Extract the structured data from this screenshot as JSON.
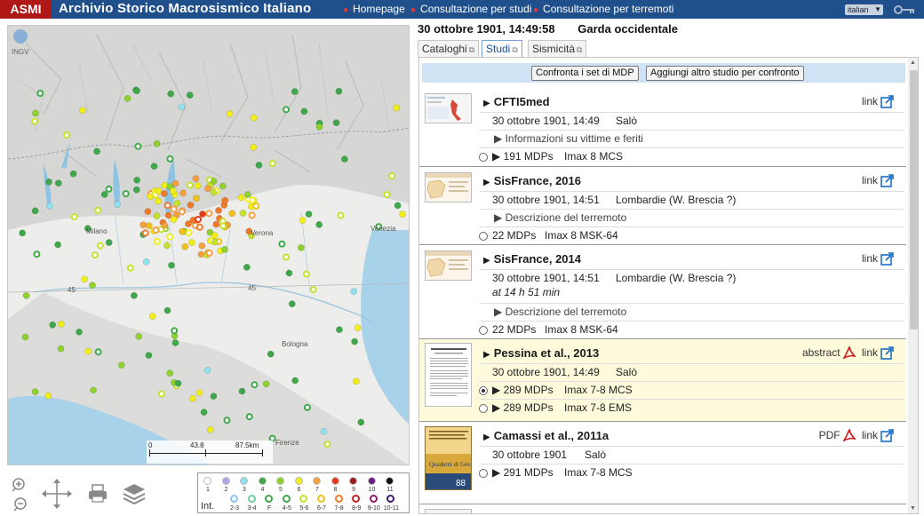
{
  "topbar": {
    "brand": "ASMI",
    "title": "Archivio Storico Macrosismico Italiano",
    "nav": [
      "Homepage",
      "Consultazione per studi",
      "Consultazione per terremoti"
    ],
    "language": "italian"
  },
  "map": {
    "labels": {
      "milano": "Milano",
      "venezia": "Venezia",
      "bologna": "Bologna",
      "firenze": "Firenze",
      "verona": "Verona",
      "lat45a": "45",
      "lat45b": "45"
    },
    "scale": {
      "zero": "0",
      "mid": "43.8",
      "end": "87.5km"
    },
    "logo": "INGV"
  },
  "legend": {
    "int_label": "Int.",
    "row1": [
      {
        "label": "1",
        "color": "#ffffff"
      },
      {
        "label": "2",
        "color": "#a9a9e8"
      },
      {
        "label": "3",
        "color": "#8fe2ef"
      },
      {
        "label": "4",
        "color": "#3fa84a"
      },
      {
        "label": "5",
        "color": "#8fd12f"
      },
      {
        "label": "6",
        "color": "#f2ee1a"
      },
      {
        "label": "7",
        "color": "#f5a142"
      },
      {
        "label": "8",
        "color": "#e43a1a"
      },
      {
        "label": "9",
        "color": "#9b1e1e"
      },
      {
        "label": "10",
        "color": "#6b1a8a"
      },
      {
        "label": "11",
        "color": "#111111"
      }
    ],
    "row2": [
      {
        "label": "2-3",
        "color": "#8fc6ef"
      },
      {
        "label": "3-4",
        "color": "#6ecfa0"
      },
      {
        "label": "F",
        "color": "#3fa84a"
      },
      {
        "label": "4-5",
        "color": "#3fa84a"
      },
      {
        "label": "5-6",
        "color": "#c6e12a"
      },
      {
        "label": "6-7",
        "color": "#f2c01a"
      },
      {
        "label": "7-8",
        "color": "#f07a2a"
      },
      {
        "label": "8-9",
        "color": "#c42020"
      },
      {
        "label": "9-10",
        "color": "#8a1a6a"
      },
      {
        "label": "10-11",
        "color": "#3a1a6a"
      }
    ]
  },
  "event": {
    "datetime": "30 ottobre 1901, 14:49:58",
    "area": "Garda occidentale"
  },
  "tabs": [
    "Cataloghi",
    "Studi",
    "Sismicità"
  ],
  "buttons": {
    "compare": "Confronta i set di MDP",
    "add": "Aggiungi altro studio per confronto"
  },
  "studies": [
    {
      "title": "CFTI5med",
      "date": "30 ottobre 1901, 14:49",
      "place": "Salò",
      "extra": "Informazioni su vittime e feriti",
      "links": [
        "link"
      ],
      "mdps": [
        {
          "count": "191 MDPs",
          "imax": "Imax 8 MCS",
          "selected": false
        }
      ]
    },
    {
      "title": "SisFrance, 2016",
      "date": "30 ottobre 1901, 14:51",
      "place": "Lombardie (W. Brescia ?)",
      "extra": "Descrizione del terremoto",
      "links": [
        "link"
      ],
      "mdps": [
        {
          "count": "22 MDPs",
          "imax": "Imax 8 MSK-64",
          "selected": false
        }
      ]
    },
    {
      "title": "SisFrance, 2014",
      "date": "30 ottobre 1901, 14:51",
      "place": "Lombardie (W. Brescia ?)",
      "note": "at 14 h 51 min",
      "extra": "Descrizione del terremoto",
      "links": [
        "link"
      ],
      "mdps": [
        {
          "count": "22 MDPs",
          "imax": "Imax 8 MSK-64",
          "selected": false
        }
      ]
    },
    {
      "title": "Pessina et al., 2013",
      "date": "30 ottobre 1901, 14:49",
      "place": "Salò",
      "links": [
        "abstract",
        "link"
      ],
      "mdps": [
        {
          "count": "289 MDPs",
          "imax": "Imax 7-8 MCS",
          "selected": true
        },
        {
          "count": "289 MDPs",
          "imax": "Imax 7-8 EMS",
          "selected": false
        }
      ]
    },
    {
      "title": "Camassi et al., 2011a",
      "date": "30 ottobre 1901",
      "place": "Salò",
      "links": [
        "PDF",
        "link"
      ],
      "mdps": [
        {
          "count": "291 MDPs",
          "imax": "Imax 7-8 MCS",
          "selected": false
        }
      ],
      "thumb_text": "Quaderni di Geofisica",
      "thumb_num": "88"
    }
  ],
  "colors": {
    "topbar": "#20508c",
    "brand": "#b01818",
    "highlight": "#fdfbdc",
    "toolbar": "#cfe3f5"
  }
}
